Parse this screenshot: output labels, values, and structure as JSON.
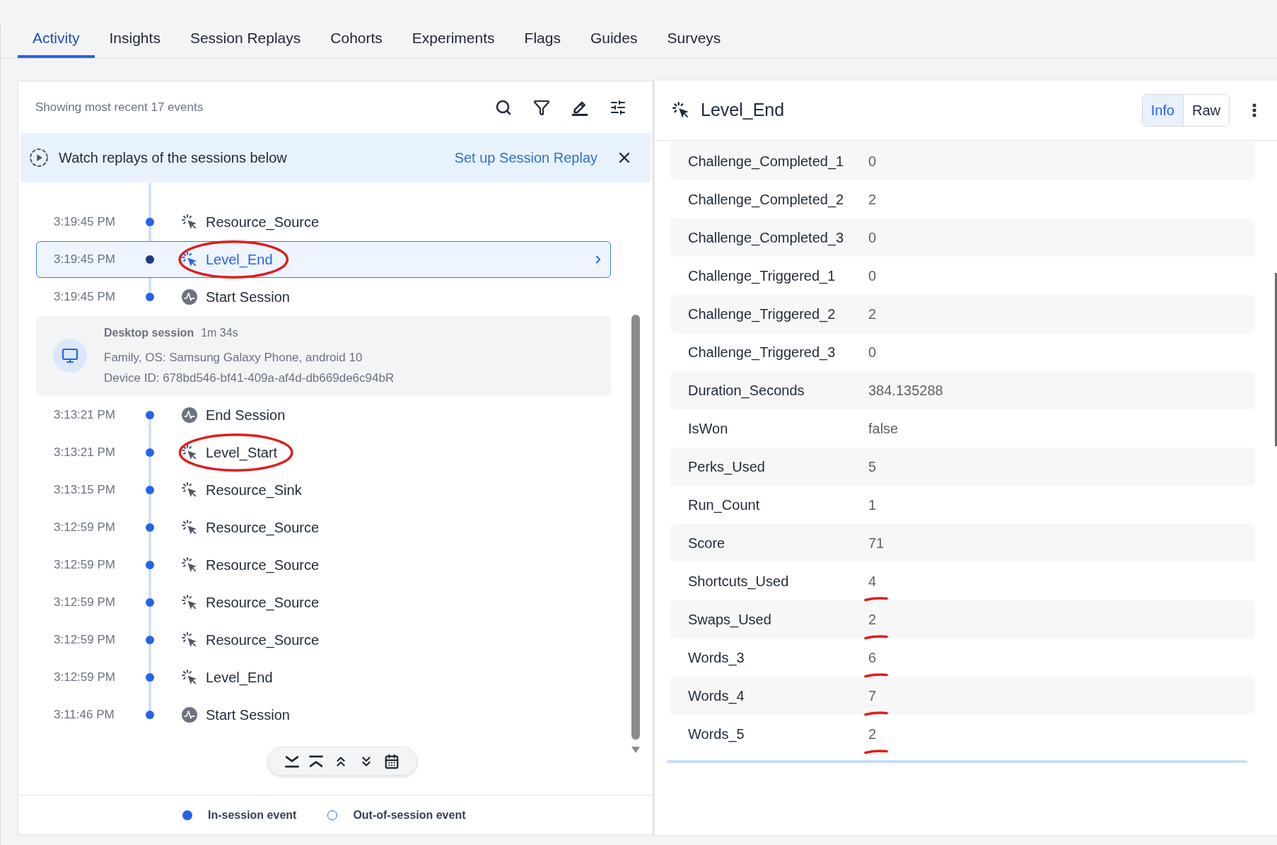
{
  "tabs": [
    {
      "label": "Activity",
      "selected": true
    },
    {
      "label": "Insights",
      "selected": false
    },
    {
      "label": "Session Replays",
      "selected": false
    },
    {
      "label": "Cohorts",
      "selected": false
    },
    {
      "label": "Experiments",
      "selected": false
    },
    {
      "label": "Flags",
      "selected": false
    },
    {
      "label": "Guides",
      "selected": false
    },
    {
      "label": "Surveys",
      "selected": false
    }
  ],
  "event_list": {
    "summary": "Showing most recent 17 events",
    "banner": {
      "text": "Watch replays of the sessions below",
      "link": "Set up Session Replay"
    },
    "timeline": [
      {
        "events": [
          {
            "time": "3:19:45 PM",
            "name": "Resource_Source",
            "kind": "custom",
            "selected": false,
            "in_session": true,
            "circled": false
          },
          {
            "time": "3:19:45 PM",
            "name": "Level_End",
            "kind": "custom",
            "selected": true,
            "in_session": true,
            "circled": true
          },
          {
            "time": "3:19:45 PM",
            "name": "Start Session",
            "kind": "session",
            "selected": false,
            "in_session": true,
            "circled": false
          }
        ]
      },
      {
        "session": {
          "title": "Desktop session",
          "duration": "1m 34s",
          "details": [
            "Family, OS: Samsung Galaxy Phone, android 10",
            "Device ID: 678bd546-bf41-409a-af4d-db669de6c94bR"
          ]
        },
        "events": [
          {
            "time": "3:13:21 PM",
            "name": "End Session",
            "kind": "session",
            "selected": false,
            "in_session": true,
            "circled": false
          },
          {
            "time": "3:13:21 PM",
            "name": "Level_Start",
            "kind": "custom",
            "selected": false,
            "in_session": true,
            "circled": true
          },
          {
            "time": "3:13:15 PM",
            "name": "Resource_Sink",
            "kind": "custom",
            "selected": false,
            "in_session": true,
            "circled": false
          },
          {
            "time": "3:12:59 PM",
            "name": "Resource_Source",
            "kind": "custom",
            "selected": false,
            "in_session": true,
            "circled": false
          },
          {
            "time": "3:12:59 PM",
            "name": "Resource_Source",
            "kind": "custom",
            "selected": false,
            "in_session": true,
            "circled": false
          },
          {
            "time": "3:12:59 PM",
            "name": "Resource_Source",
            "kind": "custom",
            "selected": false,
            "in_session": true,
            "circled": false
          },
          {
            "time": "3:12:59 PM",
            "name": "Resource_Source",
            "kind": "custom",
            "selected": false,
            "in_session": true,
            "circled": false
          },
          {
            "time": "3:12:59 PM",
            "name": "Level_End",
            "kind": "custom",
            "selected": false,
            "in_session": true,
            "circled": false
          },
          {
            "time": "3:11:46 PM",
            "name": "Start Session",
            "kind": "session",
            "selected": false,
            "in_session": true,
            "circled": false
          }
        ]
      }
    ],
    "legend": [
      {
        "label": "In-session event",
        "kind": "in_session"
      },
      {
        "label": "Out-of-session event",
        "kind": "out_of_session"
      }
    ]
  },
  "detail": {
    "title": "Level_End",
    "view_toggle": [
      {
        "label": "Info",
        "selected": true
      },
      {
        "label": "Raw",
        "selected": false
      }
    ],
    "properties": [
      {
        "key": "Challenge_Completed_1",
        "value": "0",
        "underlined": false
      },
      {
        "key": "Challenge_Completed_2",
        "value": "2",
        "underlined": false
      },
      {
        "key": "Challenge_Completed_3",
        "value": "0",
        "underlined": false
      },
      {
        "key": "Challenge_Triggered_1",
        "value": "0",
        "underlined": false
      },
      {
        "key": "Challenge_Triggered_2",
        "value": "2",
        "underlined": false
      },
      {
        "key": "Challenge_Triggered_3",
        "value": "0",
        "underlined": false
      },
      {
        "key": "Duration_Seconds",
        "value": "384.135288",
        "underlined": false
      },
      {
        "key": "IsWon",
        "value": "false",
        "underlined": false
      },
      {
        "key": "Perks_Used",
        "value": "5",
        "underlined": false
      },
      {
        "key": "Run_Count",
        "value": "1",
        "underlined": false
      },
      {
        "key": "Score",
        "value": "71",
        "underlined": false
      },
      {
        "key": "Shortcuts_Used",
        "value": "4",
        "underlined": true
      },
      {
        "key": "Swaps_Used",
        "value": "2",
        "underlined": true
      },
      {
        "key": "Words_3",
        "value": "6",
        "underlined": true
      },
      {
        "key": "Words_4",
        "value": "7",
        "underlined": true
      },
      {
        "key": "Words_5",
        "value": "2",
        "underlined": true
      }
    ]
  }
}
